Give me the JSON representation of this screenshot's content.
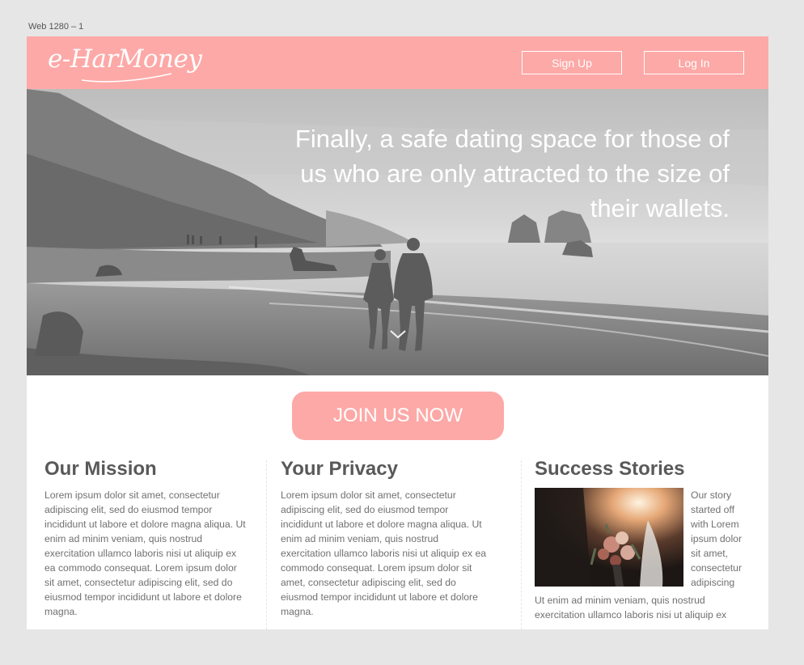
{
  "artboard": {
    "label": "Web 1280 – 1"
  },
  "header": {
    "logo_text": "e-HarMoney",
    "signup_label": "Sign Up",
    "login_label": "Log In"
  },
  "hero": {
    "tagline": "Finally, a safe dating space for those of us who are only attracted to the size of their wallets.",
    "scroll_icon": "chevron-down-icon"
  },
  "cta": {
    "join_label": "JOIN US NOW"
  },
  "mission": {
    "title": "Our Mission",
    "body": "Lorem ipsum dolor sit amet, consectetur adipiscing elit, sed do eiusmod tempor incididunt ut labore et dolore magna aliqua. Ut enim ad minim veniam, quis nostrud exercitation ullamco laboris nisi ut aliquip ex ea commodo consequat. Lorem ipsum dolor sit amet, consectetur adipiscing elit, sed do eiusmod tempor incididunt ut labore et dolore magna."
  },
  "privacy": {
    "title": "Your Privacy",
    "body": "Lorem ipsum dolor sit amet, consectetur adipiscing elit, sed do eiusmod tempor incididunt ut labore et dolore magna aliqua. Ut enim ad minim veniam, quis nostrud exercitation ullamco laboris nisi ut aliquip ex ea commodo consequat. Lorem ipsum dolor sit amet, consectetur adipiscing elit, sed do eiusmod tempor incididunt ut labore et dolore magna."
  },
  "stories": {
    "title": "Success Stories",
    "side_text": "Our story started off with Lorem ipsum dolor sit amet, consectetur adipiscing",
    "bottom_text": "Ut enim ad minim veniam, quis nostrud exercitation ullamco laboris nisi ut aliquip ex"
  },
  "colors": {
    "accent": "#fda9a7",
    "text": "#707070",
    "heading": "#595959"
  }
}
